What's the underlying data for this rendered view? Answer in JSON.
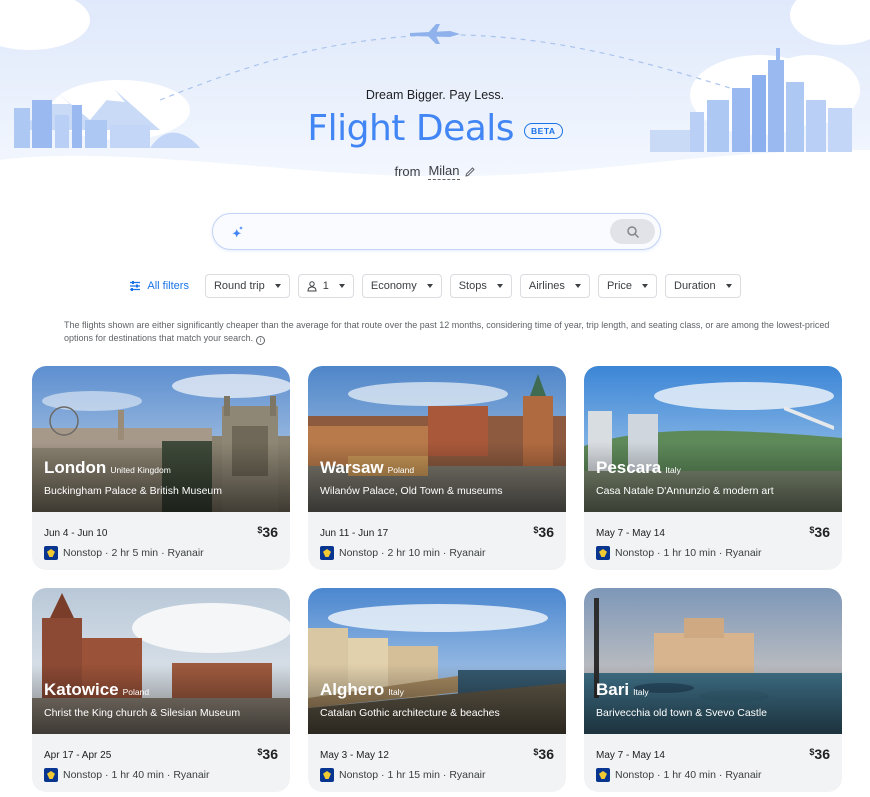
{
  "hero": {
    "tagline": "Dream Bigger. Pay Less.",
    "title": "Flight Deals",
    "beta": "BETA",
    "from_label": "from",
    "from_city": "Milan"
  },
  "search": {
    "placeholder": "",
    "value": ""
  },
  "filters": {
    "all_filters": "All filters",
    "chips": [
      "Round trip",
      "1",
      "Economy",
      "Stops",
      "Airlines",
      "Price",
      "Duration"
    ]
  },
  "disclaimer": "The flights shown are either significantly cheaper than the average for that route over the past 12 months, considering time of year, trip length, and seating class, or are among the lowest-priced options for destinations that match your search.",
  "colors": {
    "accent": "#1a73e8",
    "title": "#4285f4",
    "card_bg": "#f1f3f4",
    "airline_logo": "#073590"
  },
  "cards": [
    {
      "city": "London",
      "country": "United Kingdom",
      "attraction": "Buckingham Palace & British Museum",
      "dates": "Jun 4 - Jun 10",
      "currency": "$",
      "price": "36",
      "stops": "Nonstop",
      "duration": "2 hr 5 min",
      "airline": "Ryanair",
      "sep": "·"
    },
    {
      "city": "Warsaw",
      "country": "Poland",
      "attraction": "Wilanów Palace, Old Town & museums",
      "dates": "Jun 11 - Jun 17",
      "currency": "$",
      "price": "36",
      "stops": "Nonstop",
      "duration": "2 hr 10 min",
      "airline": "Ryanair",
      "sep": "·"
    },
    {
      "city": "Pescara",
      "country": "Italy",
      "attraction": "Casa Natale D'Annunzio & modern art",
      "dates": "May 7 - May 14",
      "currency": "$",
      "price": "36",
      "stops": "Nonstop",
      "duration": "1 hr 10 min",
      "airline": "Ryanair",
      "sep": "·"
    },
    {
      "city": "Katowice",
      "country": "Poland",
      "attraction": "Christ the King church & Silesian Museum",
      "dates": "Apr 17 - Apr 25",
      "currency": "$",
      "price": "36",
      "stops": "Nonstop",
      "duration": "1 hr 40 min",
      "airline": "Ryanair",
      "sep": "·"
    },
    {
      "city": "Alghero",
      "country": "Italy",
      "attraction": "Catalan Gothic architecture & beaches",
      "dates": "May 3 - May 12",
      "currency": "$",
      "price": "36",
      "stops": "Nonstop",
      "duration": "1 hr 15 min",
      "airline": "Ryanair",
      "sep": "·"
    },
    {
      "city": "Bari",
      "country": "Italy",
      "attraction": "Barivecchia old town & Svevo Castle",
      "dates": "May 7 - May 14",
      "currency": "$",
      "price": "36",
      "stops": "Nonstop",
      "duration": "1 hr 40 min",
      "airline": "Ryanair",
      "sep": "·"
    }
  ]
}
